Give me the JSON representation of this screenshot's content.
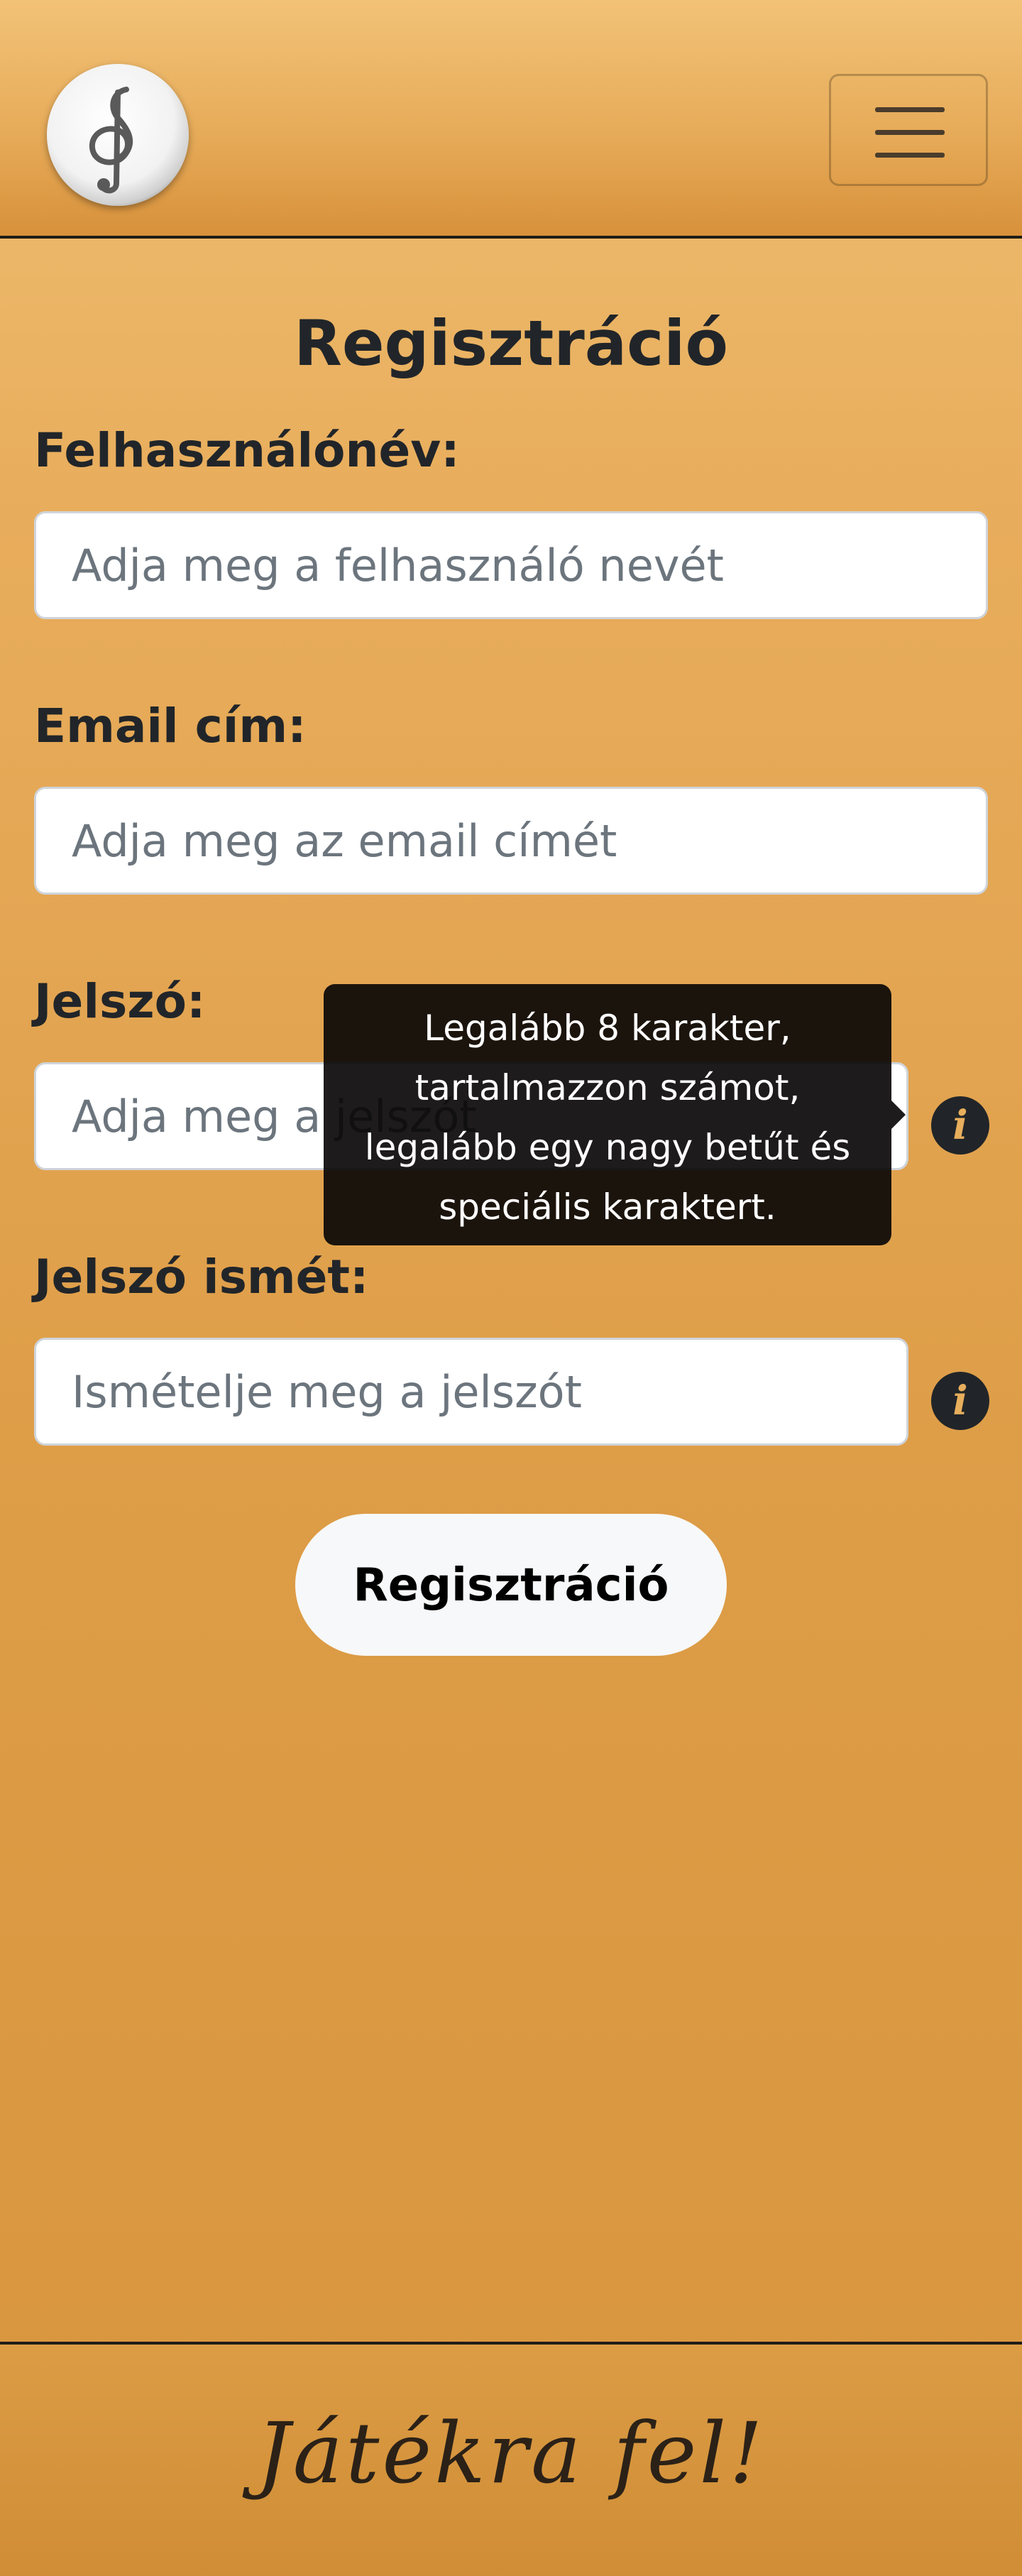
{
  "header": {
    "logo_icon": "treble-clef-icon",
    "menu_icon": "hamburger-menu-icon"
  },
  "form": {
    "title": "Regisztráció",
    "username": {
      "label": "Felhasználónév:",
      "placeholder": "Adja meg a felhasználó nevét"
    },
    "email": {
      "label": "Email cím:",
      "placeholder": "Adja meg az email címét"
    },
    "password": {
      "label": "Jelszó:",
      "placeholder": "Adja meg a jelszót",
      "info_icon": "i"
    },
    "password_repeat": {
      "label": "Jelszó ismét:",
      "placeholder": "Ismételje meg a jelszót",
      "info_icon": "i"
    },
    "submit_label": "Regisztráció"
  },
  "tooltip": {
    "lines": [
      "Legalább 8 karakter,",
      "tartalmazzon számot,",
      "legalább egy nagy betűt és",
      "speciális karaktert."
    ]
  },
  "footer": {
    "text": "Játékra fel!"
  },
  "colors": {
    "background": "#e8ad5c",
    "text": "#212529",
    "tooltip_bg": "#0a0808",
    "button_bg": "#f7f8f9",
    "info_icon_fg": "#e7ae5c"
  }
}
